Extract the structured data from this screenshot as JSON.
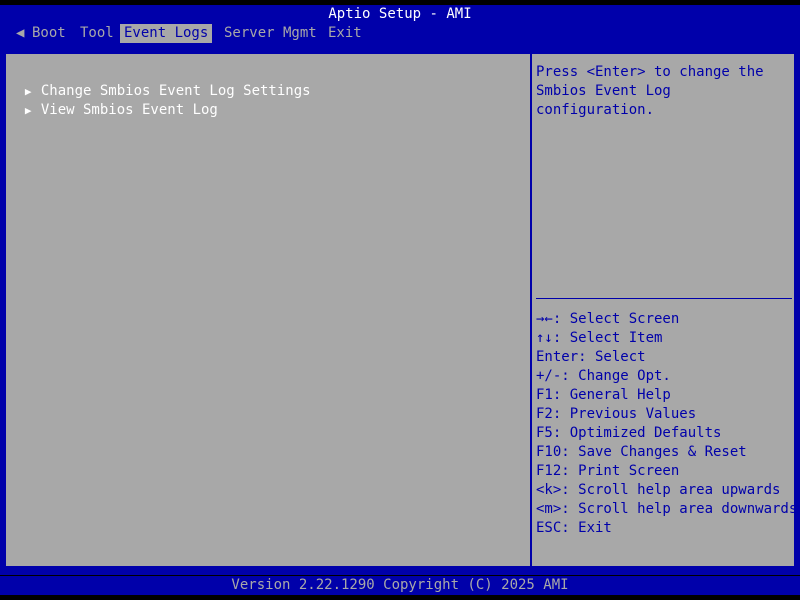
{
  "title": "Aptio Setup - AMI",
  "menu": {
    "prev_arrow": "◀",
    "tabs": [
      {
        "label": "Boot"
      },
      {
        "label": "Tool"
      },
      {
        "label": "Event Logs"
      },
      {
        "label": "Server Mgmt"
      },
      {
        "label": "Exit"
      }
    ],
    "active_tab": "Event Logs"
  },
  "main": {
    "items": [
      {
        "label": "Change Smbios Event Log Settings",
        "marker": "▶"
      },
      {
        "label": "View Smbios Event Log",
        "marker": "▶"
      }
    ]
  },
  "help": {
    "text": "Press <Enter> to change the Smbios Event Log configuration."
  },
  "keys": [
    {
      "text": "→←: Select Screen"
    },
    {
      "text": "↑↓: Select Item"
    },
    {
      "text": "Enter: Select"
    },
    {
      "text": "+/-: Change Opt."
    },
    {
      "text": "F1: General Help"
    },
    {
      "text": "F2: Previous Values"
    },
    {
      "text": "F5: Optimized Defaults"
    },
    {
      "text": "F10: Save Changes & Reset"
    },
    {
      "text": "F12: Print Screen"
    },
    {
      "text": "<k>: Scroll help area upwards"
    },
    {
      "text": "<m>: Scroll help area downwards"
    },
    {
      "text": "ESC: Exit"
    }
  ],
  "footer": {
    "version": "Version 2.22.1290 Copyright (C) 2025 AMI"
  },
  "colors": {
    "bios_blue": "#0000aa",
    "bios_gray": "#a8a8a8",
    "text_white": "#ffffff"
  }
}
